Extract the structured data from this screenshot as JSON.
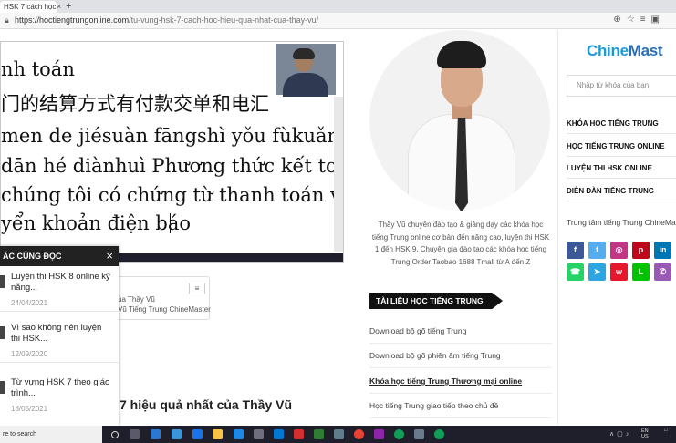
{
  "browser": {
    "tab_title": "HSK 7 cách học hiệu qu...",
    "tab_close": "×",
    "tab_new": "+",
    "url_host": "https://hoctiengtrungonline.com",
    "url_path": "/tu-vung-hsk-7-cach-hoc-hieu-qua-nhat-cua-thay-vu/"
  },
  "video": {
    "lines": [
      "nh toán",
      "门的结算方式有付款交单和电汇",
      "men de jiésuàn fāngshì yǒu fùkuǎn",
      "dān hé diànhuì Phương thức kết toán",
      "chúng tôi có chứng từ thanh toán và",
      "yển khoản điện báo"
    ]
  },
  "related": {
    "header": "ÁC CŨNG ĐỌC",
    "close": "×",
    "items": [
      {
        "title": "Luyện thi HSK 8 online kỹ năng...",
        "date": "24/04/2021"
      },
      {
        "title": "Vì sao không nên luyện thi HSK...",
        "date": "12/09/2020"
      },
      {
        "title": "Từ vựng HSK 7 theo giáo trình...",
        "date": "18/05/2021"
      }
    ]
  },
  "author_box": {
    "line1": "ủa Thầy Vũ",
    "line2": "Vũ Tiếng Trung ChineMaster"
  },
  "article_heading": "K 7 hiệu quả nhất của Thầy Vũ",
  "bio": "Thầy Vũ chuyên đào tạo & giảng dạy các khóa học tiếng Trung online cơ bản đến nâng cao, luyện thi HSK 1 đến HSK 9, Chuyên gia đào tạo các khóa học tiếng Trung Order Taobao 1688 Tmall từ A đến Z",
  "docs": {
    "header": "TÀI LIỆU HỌC TIẾNG TRUNG",
    "links": [
      "Download bộ gõ tiếng Trung",
      "Download bộ gõ phiên âm tiếng Trung",
      "Khóa học tiếng Trung Thương mại online",
      "Học tiếng Trung giao tiếp theo chủ đề"
    ]
  },
  "sidebar": {
    "logo_a": "Chine",
    "logo_b": "Mast",
    "search_placeholder": "Nhập từ khóa của bạn",
    "menu": [
      "KHÓA HỌC TIẾNG TRUNG",
      "HỌC TIẾNG TRUNG ONLINE",
      "LUYỆN THI HSK ONLINE",
      "DIỄN ĐÀN TIẾNG TRUNG"
    ],
    "center": "Trung tâm tiếng Trung ChineMast",
    "social_colors": [
      "#3b5998",
      "#55acee",
      "#c13584",
      "#bd081c",
      "#0077b5",
      "#25d366",
      "#2ca5e0",
      "#e6162d",
      "#00c300",
      "#9b59b6"
    ]
  },
  "taskbar": {
    "search": "re to search",
    "lang": "EN\nUS"
  }
}
